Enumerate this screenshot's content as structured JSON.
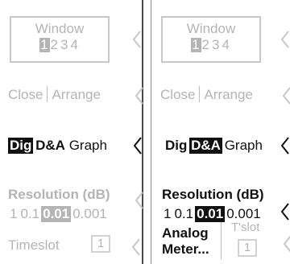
{
  "panels": [
    {
      "window": {
        "title": "Window",
        "numbers": [
          "1",
          "2",
          "3",
          "4"
        ],
        "selected": "1"
      },
      "close_label": "Close",
      "arrange_label": "Arrange",
      "view_tabs": [
        "Dig",
        "D&A",
        "Graph"
      ],
      "selected_tab": "Dig",
      "resolution_label": "Resolution (dB)",
      "resolution_values": [
        "1",
        "0.1",
        "0.01",
        "0.001"
      ],
      "selected_resolution": "0.01",
      "timeslot_label": "Timeslot",
      "timeslot_value": "1"
    },
    {
      "window": {
        "title": "Window",
        "numbers": [
          "1",
          "2",
          "3",
          "4"
        ],
        "selected": "1"
      },
      "close_label": "Close",
      "arrange_label": "Arrange",
      "view_tabs": [
        "Dig",
        "D&A",
        "Graph"
      ],
      "selected_tab": "D&A",
      "resolution_label": "Resolution (dB)",
      "resolution_values": [
        "1",
        "0.1",
        "0.01",
        "0.001"
      ],
      "selected_resolution": "0.01",
      "analog_meter_line1": "Analog",
      "analog_meter_line2": "Meter...",
      "timeslot_label": "T'slot",
      "timeslot_value": "1"
    }
  ],
  "icons": {
    "row_pointer": "left-triangle-icon"
  },
  "colors": {
    "text_dark": "#111111",
    "text_dim": "#b4b4b4",
    "selected_bg": "#111111",
    "selected_bg_dim": "#b4b4b4"
  }
}
